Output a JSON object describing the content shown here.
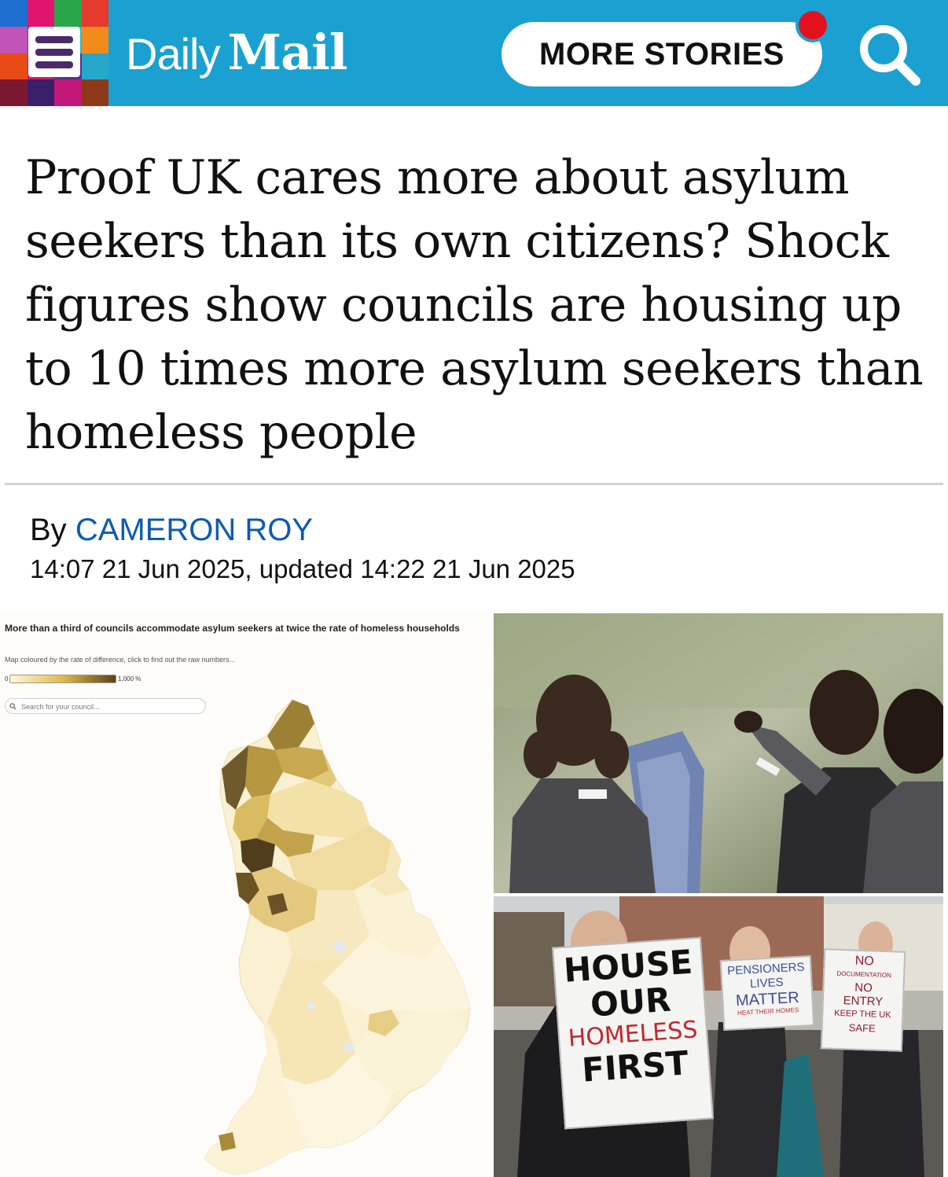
{
  "header": {
    "logo_daily": "Daily",
    "logo_mail": "Mail",
    "more_stories": "MORE STORIES",
    "brand_color": "#1ba1d1",
    "notification_color": "#e3101e",
    "icons": [
      "hamburger-menu-icon",
      "search-icon"
    ]
  },
  "article": {
    "headline": "Proof UK cares more about asylum seekers than its own citizens? Shock figures show councils are housing up to 10 times more asylum seekers than homeless people",
    "by": "By",
    "author": "CAMERON ROY",
    "dateline": "14:07 21 Jun 2025, updated 14:22 21 Jun 2025"
  },
  "map_graphic": {
    "title": "More than a third of councils accommodate asylum seekers at twice the rate of homeless households",
    "subtitle": "Map coloured by the rate of difference, click to find out the raw numbers...",
    "legend_min": "0",
    "legend_max": "1,000 %",
    "search_placeholder": "Search for your council..."
  },
  "protest_photo": {
    "sign1_line1": "HOUSE",
    "sign1_line2": "OUR",
    "sign1_line3": "HOMELESS",
    "sign1_line4": "FIRST",
    "sign2_line1": "PENSIONERS",
    "sign2_line2": "LIVES",
    "sign2_line3": "MATTER",
    "sign2_line4": "HEAT THEIR HOMES",
    "sign3_line1": "NO",
    "sign3_line2": "DOCUMENTATION",
    "sign3_line3": "NO",
    "sign3_line4": "ENTRY",
    "sign3_line5": "KEEP THE UK",
    "sign3_line6": "SAFE"
  }
}
